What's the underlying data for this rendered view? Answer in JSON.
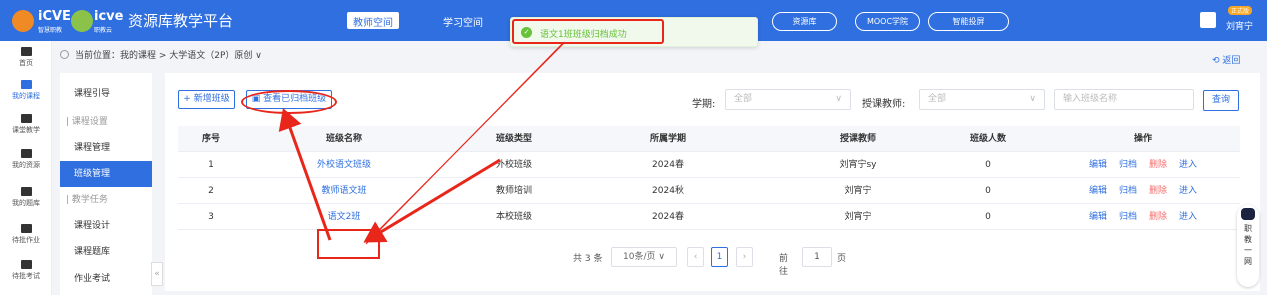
{
  "header": {
    "logo1_text": "iCVE",
    "logo1_sub": "智慧职教",
    "logo2_text": "icve",
    "logo2_sub": "职教云",
    "platform_title": "资源库教学平台",
    "teacher_space": "教师空间",
    "study_space": "学习空间",
    "nav_pills": [
      "资源库",
      "MOOC学院",
      "智能投屏"
    ],
    "user_name": "刘宵宁",
    "user_badge": "正式版",
    "accent": "#2f6fe0"
  },
  "toast": {
    "text": "语文1班班级归档成功",
    "color": "#67c23a"
  },
  "rail": [
    {
      "label": "首页",
      "icon": "home-icon"
    },
    {
      "label": "我的课程",
      "icon": "course-icon"
    },
    {
      "label": "课堂教学",
      "icon": "play-icon"
    },
    {
      "label": "我的资源",
      "icon": "resource-icon"
    },
    {
      "label": "我的题库",
      "icon": "question-bank-icon"
    },
    {
      "label": "待批作业",
      "icon": "homework-icon"
    },
    {
      "label": "待批考试",
      "icon": "exam-icon"
    }
  ],
  "breadcrumb": "当前位置：我的课程 > 大学语文（2P）原创 ∨",
  "back_label": "返回",
  "submenu": {
    "items": [
      "课程引导",
      "课程设置",
      "课程管理",
      "班级管理",
      "教学任务",
      "课程设计",
      "课程题库",
      "作业考试"
    ]
  },
  "toolbar": {
    "add_class": "+ 新增班级",
    "view_archived": "查看已归档班级",
    "term_label": "学期:",
    "term_value": "全部",
    "teacher_label": "授课教师:",
    "teacher_value": "全部",
    "search_placeholder": "输入班级名称",
    "search_button": "查询"
  },
  "table": {
    "headers": [
      "序号",
      "班级名称",
      "班级类型",
      "所属学期",
      "授课教师",
      "班级人数",
      "操作"
    ],
    "rows": [
      [
        "1",
        "外校语文班级",
        "外校班级",
        "2024春",
        "刘宵宁sy",
        "0"
      ],
      [
        "2",
        "教师语文班",
        "教师培训",
        "2024秋",
        "刘宵宁",
        "0"
      ],
      [
        "3",
        "语文2班",
        "本校班级",
        "2024春",
        "刘宵宁",
        "0"
      ]
    ],
    "ops": [
      "编辑",
      "归档",
      "删除",
      "进入"
    ]
  },
  "pager": {
    "total": "共 3 条",
    "page_size": "10条/页",
    "current_page": "1",
    "goto_label": "前往",
    "goto_value": "1",
    "page_unit": "页"
  },
  "assistant_label": "职教一网",
  "annotation_color": "#e8261a"
}
